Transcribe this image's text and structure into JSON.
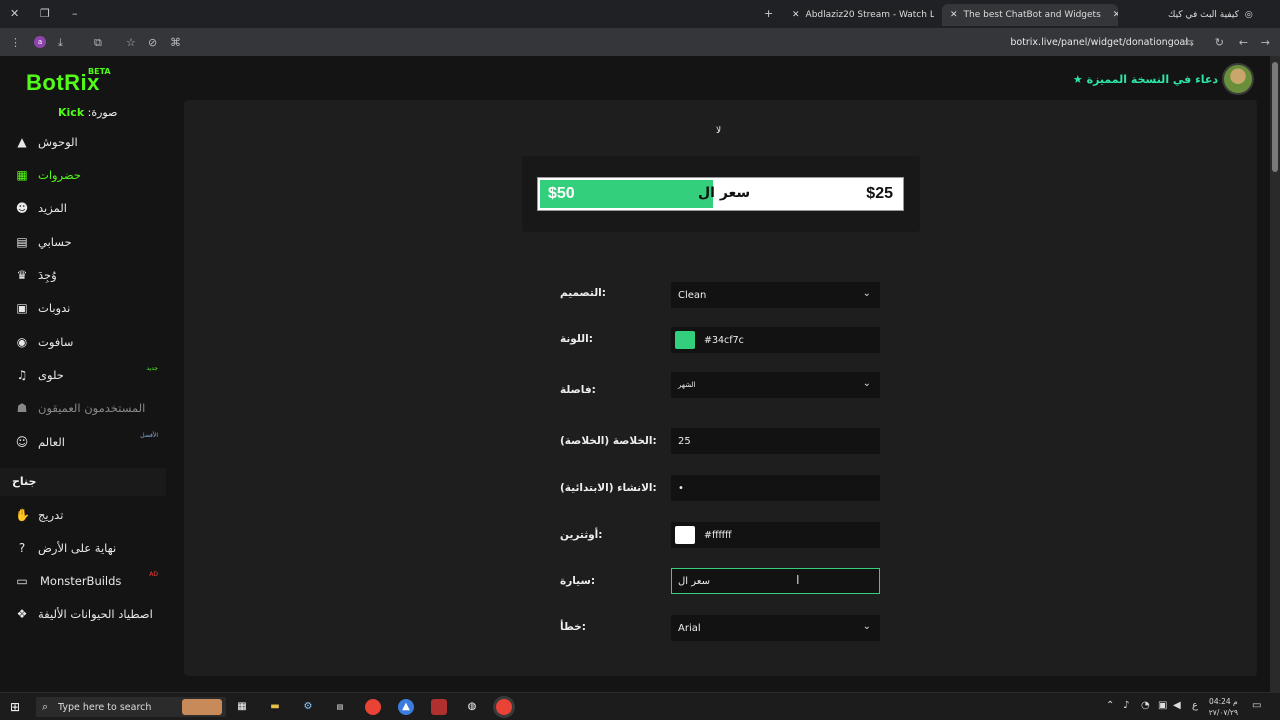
{
  "browser": {
    "tabs": [
      {
        "title": "Abdlaziz20 Stream - Watch Live",
        "active": false
      },
      {
        "title": "The best ChatBot and Widgets",
        "active": true
      },
      {
        "title": "كيفية البث في كيك",
        "active": false
      }
    ],
    "url": "botrix.live/panel/widget/donationgoal",
    "profile_initial": "a"
  },
  "header": {
    "logo": "BotRix",
    "beta": "BETA",
    "announcement": "دعاء في النسخة المميزة"
  },
  "sidebar": {
    "kick_prefix": "صورة:",
    "kick_label": "Kick",
    "items": [
      {
        "label": "الوحوش",
        "icon": "warning-icon",
        "badge": ""
      },
      {
        "label": "حضروات",
        "icon": "grid-icon",
        "badge": ""
      },
      {
        "label": "المزيد",
        "icon": "robot-icon",
        "badge": ""
      },
      {
        "label": "حسابي",
        "icon": "id-card-icon",
        "badge": ""
      },
      {
        "label": "وُجِدَ",
        "icon": "trophy-icon",
        "badge": ""
      },
      {
        "label": "ندوبات",
        "icon": "calendar-icon",
        "badge": ""
      },
      {
        "label": "سافوت",
        "icon": "gamepad-icon",
        "badge": ""
      },
      {
        "label": "حلوى",
        "icon": "music-icon",
        "badge": "جديد"
      },
      {
        "label": "المستخدمون العميقون",
        "icon": "users-icon",
        "badge": ""
      },
      {
        "label": "العالم",
        "icon": "people-icon",
        "badge": "الأفضل"
      }
    ],
    "section_title": "جناح",
    "section_items": [
      {
        "label": "تدريج",
        "icon": "hand-icon",
        "badge": ""
      },
      {
        "label": "نهاية على الأرض",
        "icon": "help-icon",
        "badge": ""
      },
      {
        "label": "MonsterBuilds",
        "icon": "laptop-icon",
        "badge": "AD"
      },
      {
        "label": "اصطياد الحيوانات الأليفة",
        "icon": "paw-icon",
        "badge": ""
      }
    ]
  },
  "preview": {
    "caption": "لا",
    "goal_current": "$25",
    "goal_title": "سعر ال",
    "goal_target": "$50",
    "progress_fraction": 0.48
  },
  "form": {
    "design": {
      "label": "التصميم:",
      "value": "Clean"
    },
    "color": {
      "label": "اللونة:",
      "value": "#34cf7c"
    },
    "separator": {
      "label": "فاصلة:",
      "value": "الشهر"
    },
    "goal_amount": {
      "label": "الخلاصة (الخلاصة):",
      "value": "25"
    },
    "start_amount": {
      "label": "الانشاء (الابتدائية):",
      "value": "•"
    },
    "text_color": {
      "label": "أوثترين:",
      "value": "#ffffff"
    },
    "title": {
      "label": "سيارة:",
      "value": "سعر ال"
    },
    "font": {
      "label": "خطأ:",
      "value": "Arial"
    }
  },
  "colors": {
    "accent": "#53fc18",
    "bar_fill": "#34cf7c",
    "text_color": "#ffffff"
  },
  "taskbar": {
    "search_placeholder": "Type here to search",
    "time": "04:24 م",
    "date": "٢٧/٠٧/٢٩",
    "lang": "ع"
  }
}
